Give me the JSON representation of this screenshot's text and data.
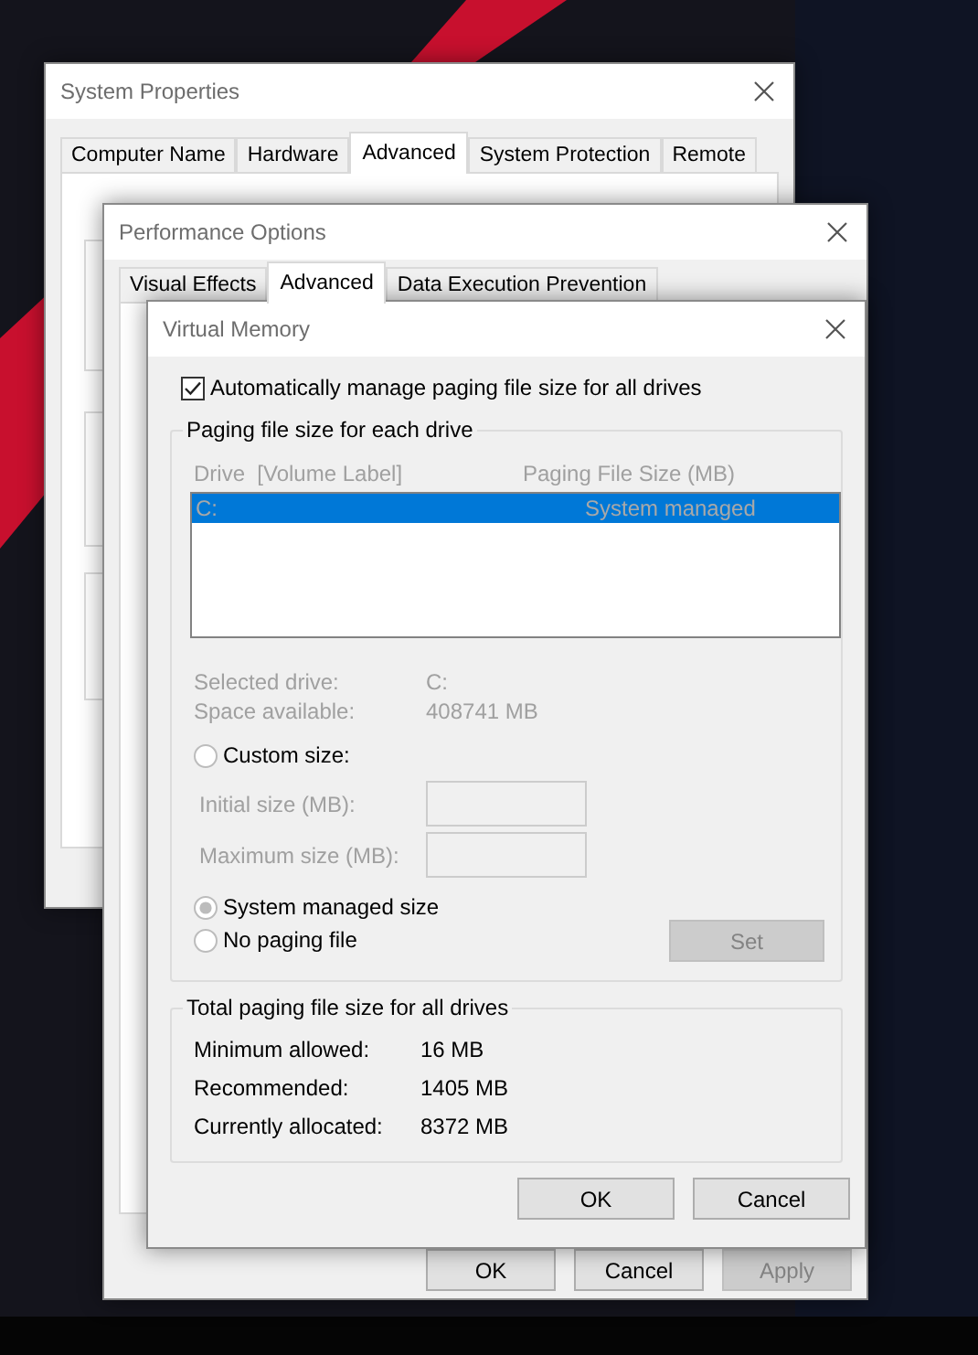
{
  "system_properties": {
    "title": "System Properties",
    "tabs": [
      {
        "label": "Computer Name",
        "selected": false
      },
      {
        "label": "Hardware",
        "selected": false
      },
      {
        "label": "Advanced",
        "selected": true
      },
      {
        "label": "System Protection",
        "selected": false
      },
      {
        "label": "Remote",
        "selected": false
      }
    ]
  },
  "performance_options": {
    "title": "Performance Options",
    "tabs": [
      {
        "label": "Visual Effects",
        "selected": false
      },
      {
        "label": "Advanced",
        "selected": true
      },
      {
        "label": "Data Execution Prevention",
        "selected": false
      }
    ],
    "buttons": [
      {
        "label": "OK",
        "disabled": false
      },
      {
        "label": "Cancel",
        "disabled": false
      },
      {
        "label": "Apply",
        "disabled": true
      }
    ]
  },
  "virtual_memory": {
    "title": "Virtual Memory",
    "auto_manage": {
      "label": "Automatically manage paging file size for all drives",
      "checked": true
    },
    "paging_group": {
      "title": "Paging file size for each drive",
      "disabled": true,
      "columns": [
        "Drive  [Volume Label]",
        "Paging File Size (MB)"
      ],
      "drives": [
        {
          "drive": "C:",
          "size": "System managed",
          "selected": true
        }
      ],
      "info": [
        {
          "label": "Selected drive:",
          "value": "C:"
        },
        {
          "label": "Space available:",
          "value": "408741 MB"
        }
      ],
      "options": [
        {
          "label": "Custom size:",
          "selected": false,
          "fields": [
            {
              "label": "Initial size (MB):"
            },
            {
              "label": "Maximum size (MB):"
            }
          ]
        },
        {
          "label": "System managed size",
          "selected": true
        },
        {
          "label": "No paging file",
          "selected": false
        }
      ],
      "set_button": {
        "label": "Set",
        "disabled": true
      }
    },
    "totals_group": {
      "title": "Total paging file size for all drives",
      "rows": [
        {
          "label": "Minimum allowed:",
          "value": "16 MB"
        },
        {
          "label": "Recommended:",
          "value": "1405 MB"
        },
        {
          "label": "Currently allocated:",
          "value": "8372 MB"
        }
      ]
    },
    "buttons": [
      {
        "label": "OK",
        "disabled": false
      },
      {
        "label": "Cancel",
        "disabled": false
      }
    ]
  }
}
